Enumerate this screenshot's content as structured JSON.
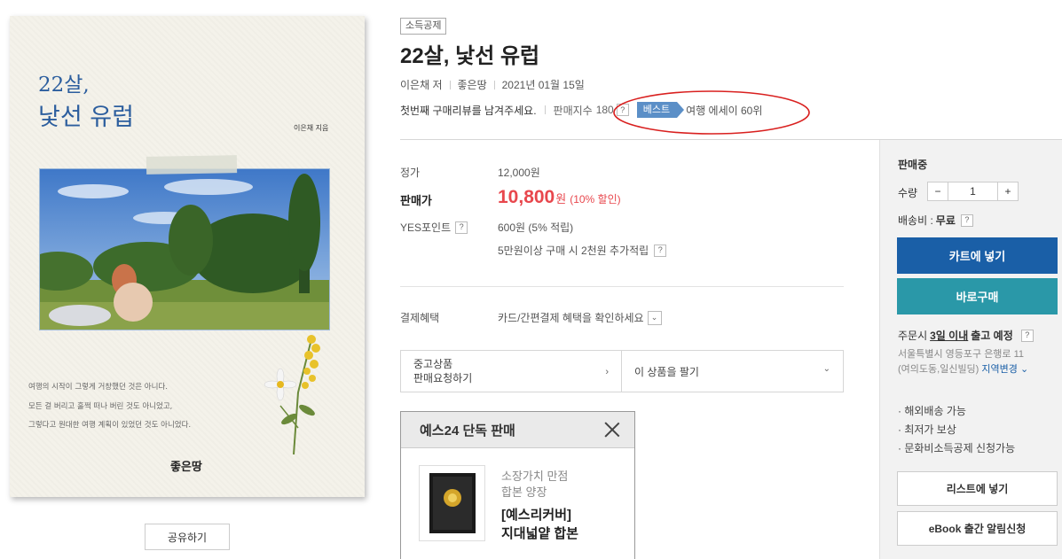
{
  "cover": {
    "title_line1": "22살,",
    "title_line2": "낯선 유럽",
    "author": "이은채 지음",
    "text_line1": "여행의 시작이 그렇게 거창했던 것은 아니다.",
    "text_line2": "모든 걸 버리고 훌쩍 떠나 버린 것도 아니었고,",
    "text_line3": "그렇다고 원대한 여행 계획이 있었던 것도 아니었다.",
    "publisher": "좋은땅"
  },
  "share_label": "공유하기",
  "product": {
    "tag": "소득공제",
    "title": "22살, 낯선 유럽",
    "author": "이은채 저",
    "publisher": "좋은땅",
    "date": "2021년 01월 15일",
    "review_prompt": "첫번째 구매리뷰를 남겨주세요.",
    "sales_index_label": "판매지수",
    "sales_index_value": "180",
    "best_badge": "베스트",
    "best_rank": "여행 에세이 60위"
  },
  "price": {
    "list_label": "정가",
    "list_value": "12,000원",
    "sale_label": "판매가",
    "sale_value": "10,800",
    "sale_unit": "원",
    "discount": "(10% 할인)",
    "points_label": "YES포인트",
    "points_value": "600원 (5% 적립)",
    "bonus_points": "5만원이상 구매 시 2천원 추가적립",
    "payment_label": "결제혜택",
    "payment_value": "카드/간편결제 혜택을 확인하세요"
  },
  "used": {
    "left_line1": "중고상품",
    "left_line2": "판매요청하기",
    "right": "이 상품을 팔기"
  },
  "exclusive": {
    "header": "예스24 단독 판매",
    "sub1": "소장가치 만점",
    "sub2": "합본 양장",
    "name1": "[예스리커버]",
    "name2": "지대넓얕 합본"
  },
  "panel": {
    "status": "판매중",
    "qty_label": "수량",
    "qty_value": "1",
    "minus": "−",
    "plus": "+",
    "shipping_label": "배송비 :",
    "shipping_value": "무료",
    "cart_button": "카트에 넣기",
    "buy_button": "바로구매",
    "delivery_prefix": "주문시",
    "delivery_highlight": "3일 이내",
    "delivery_suffix": "출고 예정",
    "address_line1": "서울특별시 영등포구 은행로 11",
    "address_line2": "(여의도동,일신빌딩)",
    "address_change": "지역변경",
    "feature1": "· 해외배송 가능",
    "feature2": "· 최저가 보상",
    "feature3": "· 문화비소득공제 신청가능",
    "list_button": "리스트에 넣기",
    "ebook_button": "eBook 출간 알림신청"
  },
  "colors": {
    "cart": "#1a5fa7",
    "buy": "#2a98a8",
    "price_red": "#e8474d",
    "best_badge": "#5b8fc7",
    "annotation": "#d9201f"
  }
}
